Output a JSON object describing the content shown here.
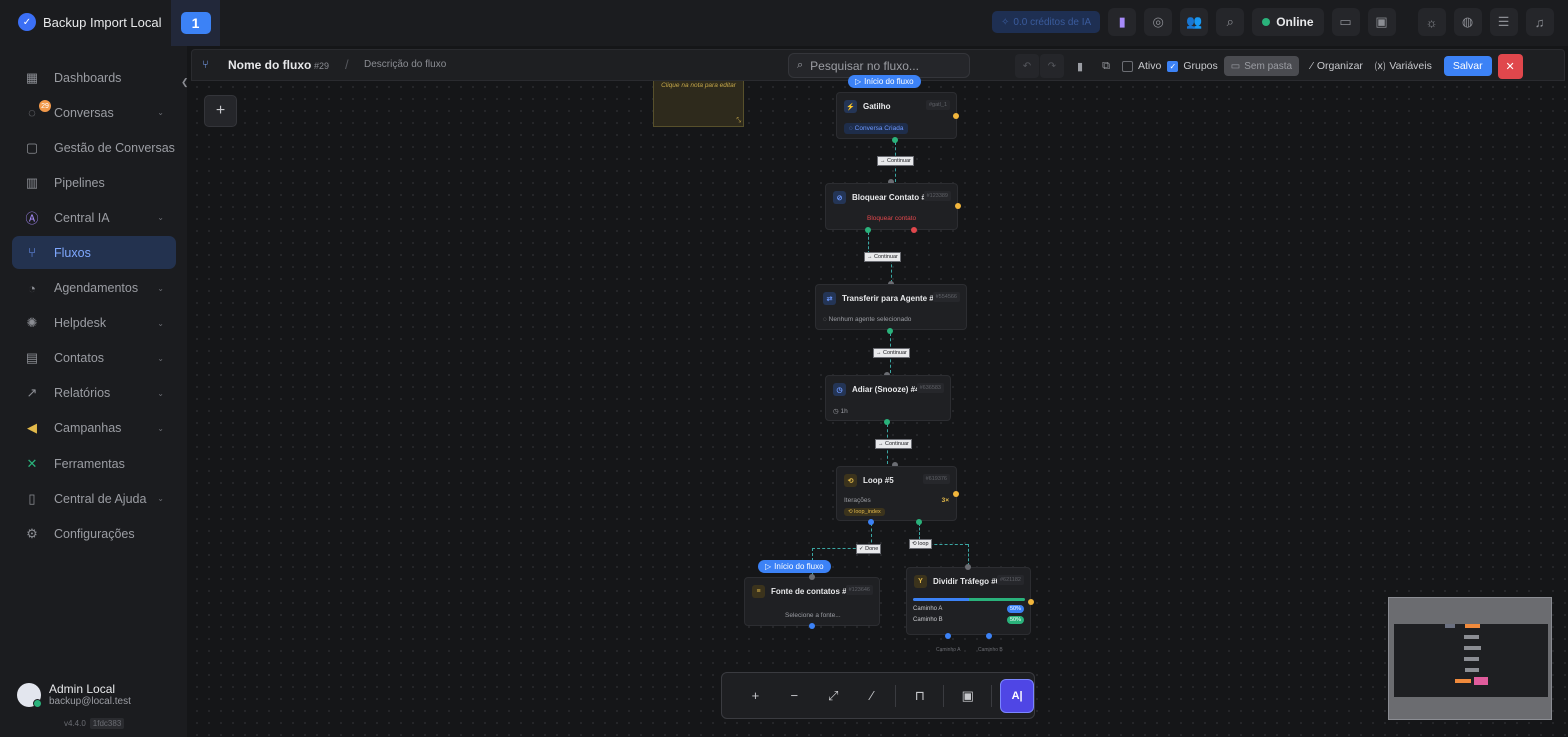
{
  "app": {
    "title": "Backup Import Local",
    "workspace": "1"
  },
  "topbar": {
    "credits": "0.0 créditos de IA",
    "status": "Online"
  },
  "sidebar": {
    "items": [
      {
        "label": "Dashboards",
        "icon": "grid-icon",
        "chevron": false
      },
      {
        "label": "Conversas",
        "icon": "chat-icon",
        "chevron": true,
        "badge": "29"
      },
      {
        "label": "Gestão de Conversas",
        "icon": "message-settings-icon",
        "chevron": false
      },
      {
        "label": "Pipelines",
        "icon": "kanban-icon",
        "chevron": false
      },
      {
        "label": "Central IA",
        "icon": "ai-icon",
        "chevron": true
      },
      {
        "label": "Fluxos",
        "icon": "flow-icon",
        "chevron": false,
        "active": true
      },
      {
        "label": "Agendamentos",
        "icon": "calendar-icon",
        "chevron": true
      },
      {
        "label": "Helpdesk",
        "icon": "help-icon",
        "chevron": true
      },
      {
        "label": "Contatos",
        "icon": "contacts-icon",
        "chevron": true
      },
      {
        "label": "Relatórios",
        "icon": "chart-icon",
        "chevron": true
      },
      {
        "label": "Campanhas",
        "icon": "megaphone-icon",
        "chevron": true
      },
      {
        "label": "Ferramentas",
        "icon": "tools-icon",
        "chevron": false
      },
      {
        "label": "Central de Ajuda",
        "icon": "book-icon",
        "chevron": true
      },
      {
        "label": "Configurações",
        "icon": "gear-icon",
        "chevron": false
      }
    ],
    "user": {
      "name": "Admin Local",
      "email": "backup@local.test"
    },
    "version": "v4.4.0",
    "build": "1fdc383"
  },
  "flowbar": {
    "name": "Nome do fluxo",
    "id": "#29",
    "separator": "/",
    "description": "Descrição do fluxo",
    "search_placeholder": "Pesquisar no fluxo...",
    "ativo": "Ativo",
    "grupos": "Grupos",
    "sem_pasta": "Sem pasta",
    "organizar": "Organizar",
    "variaveis": "Variáveis",
    "salvar": "Salvar"
  },
  "canvas": {
    "note": "Clique na nota para editar",
    "start_label": "Início do fluxo",
    "continuar": "Continuar",
    "done": "Done",
    "loop_edge": "loop",
    "nodes": {
      "gatilho": {
        "title": "Gatilho",
        "id": "#gatl_1",
        "tag": "Conversa Criada"
      },
      "bloquear": {
        "title": "Bloquear Contato #1",
        "id": "#123389",
        "body": "Bloquear contato"
      },
      "transferir": {
        "title": "Transferir para Agente #2",
        "id": "#554566",
        "body": "Nenhum agente selecionado"
      },
      "adiar": {
        "title": "Adiar (Snooze) #4",
        "id": "#636583",
        "body": "1h"
      },
      "loop": {
        "title": "Loop #5",
        "id": "#619376",
        "iter_label": "Iterações",
        "iter_value": "3×",
        "var": "loop_index"
      },
      "fonte": {
        "title": "Fonte de contatos #7",
        "id": "#123646",
        "body": "Selecione a fonte..."
      },
      "dividir": {
        "title": "Dividir Tráfego #6",
        "id": "#621182",
        "path_a": "Caminho A",
        "path_b": "Caminho B",
        "pct_a": "50%",
        "pct_b": "50%",
        "out_a": "Caminho A",
        "out_b": "Caminho B"
      }
    }
  },
  "colors": {
    "accent": "#3c82f6",
    "online": "#2ab27b",
    "danger": "#e0474c",
    "handle": "#f2b63c"
  }
}
